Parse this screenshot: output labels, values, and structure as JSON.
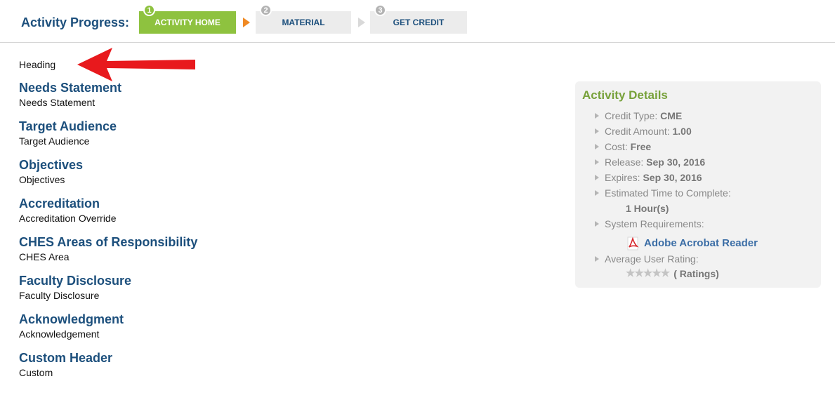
{
  "progress": {
    "label": "Activity Progress:",
    "steps": [
      {
        "num": "1",
        "label": "ACTIVITY HOME"
      },
      {
        "num": "2",
        "label": "MATERIAL"
      },
      {
        "num": "3",
        "label": "GET CREDIT"
      }
    ]
  },
  "main": {
    "heading": "Heading",
    "sections": [
      {
        "title": "Needs Statement",
        "body": "Needs Statement"
      },
      {
        "title": "Target Audience",
        "body": "Target Audience"
      },
      {
        "title": "Objectives",
        "body": "Objectives"
      },
      {
        "title": "Accreditation",
        "body": "Accreditation Override"
      },
      {
        "title": "CHES Areas of Responsibility",
        "body": "CHES Area"
      },
      {
        "title": "Faculty Disclosure",
        "body": "Faculty Disclosure"
      },
      {
        "title": "Acknowledgment",
        "body": "Acknowledgement"
      },
      {
        "title": "Custom Header",
        "body": "Custom"
      }
    ]
  },
  "details": {
    "title": "Activity Details",
    "credit_type_label": "Credit Type:",
    "credit_type_value": "CME",
    "credit_amount_label": "Credit Amount:",
    "credit_amount_value": "1.00",
    "cost_label": "Cost:",
    "cost_value": "Free",
    "release_label": "Release:",
    "release_value": "Sep 30, 2016",
    "expires_label": "Expires:",
    "expires_value": "Sep 30, 2016",
    "time_label": "Estimated Time to Complete:",
    "time_value": "1 Hour(s)",
    "system_label": "System Requirements:",
    "acrobat_link": "Adobe Acrobat Reader",
    "rating_label": "Average User Rating:",
    "rating_stars": "★★★★★",
    "rating_text": "( Ratings)"
  },
  "colors": {
    "accent_green": "#8ec23f",
    "title_blue": "#1c4f7c",
    "details_green": "#77a13a",
    "arrow_red": "#e8191d"
  },
  "icons": [
    "step-arrow-icon",
    "red-arrow-icon",
    "bullet-triangle-icon",
    "pdf-icon",
    "star-icon"
  ]
}
